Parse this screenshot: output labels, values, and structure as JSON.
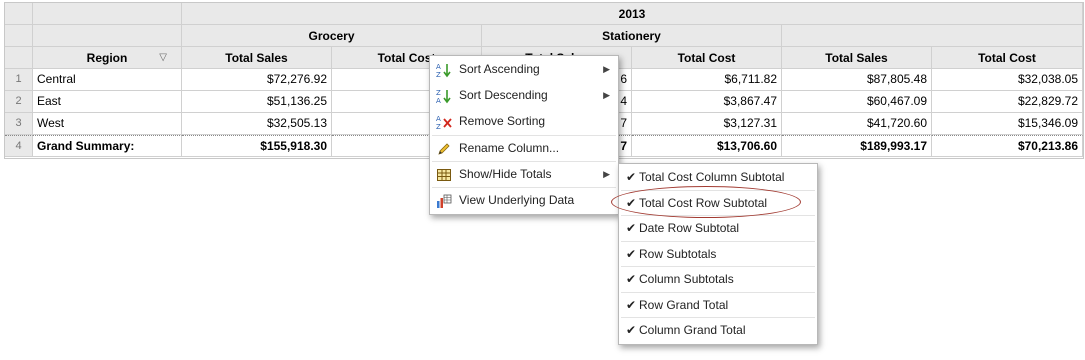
{
  "header": {
    "year": "2013",
    "groups": [
      "Grocery",
      "Stationery",
      ""
    ]
  },
  "columns": {
    "region": "Region",
    "total_sales": "Total Sales",
    "total_cost": "Total Cost"
  },
  "rows": [
    {
      "num": "1",
      "region": "Central",
      "g_sales": "$72,276.92",
      "g_cost": "$2",
      "s_sales": "6",
      "s_cost": "$6,711.82",
      "o_sales": "$87,805.48",
      "o_cost": "$32,038.05"
    },
    {
      "num": "2",
      "region": "East",
      "g_sales": "$51,136.25",
      "g_cost": "$1",
      "s_sales": "4",
      "s_cost": "$3,867.47",
      "o_sales": "$60,467.09",
      "o_cost": "$22,829.72"
    },
    {
      "num": "3",
      "region": "West",
      "g_sales": "$32,505.13",
      "g_cost": "$1",
      "s_sales": "7",
      "s_cost": "$3,127.31",
      "o_sales": "$41,720.60",
      "o_cost": "$15,346.09"
    }
  ],
  "summary": {
    "num": "4",
    "label": "Grand Summary:",
    "g_sales": "$155,918.30",
    "g_cost": "$56",
    "s_sales": "7",
    "s_cost": "$13,706.60",
    "o_sales": "$189,993.17",
    "o_cost": "$70,213.86"
  },
  "partial_header": "Total Sales",
  "context_menu": {
    "items": [
      {
        "label": "Sort Ascending",
        "icon": "sort-ascending-icon"
      },
      {
        "label": "Sort Descending",
        "icon": "sort-descending-icon"
      },
      {
        "label": "Remove Sorting",
        "icon": "remove-sorting-icon"
      },
      {
        "label": "Rename Column...",
        "icon": "pencil-icon"
      },
      {
        "label": "Show/Hide Totals",
        "icon": "table-icon"
      },
      {
        "label": "View Underlying Data",
        "icon": "data-view-icon"
      }
    ]
  },
  "submenu": {
    "items": [
      {
        "label": "Total Cost Column Subtotal"
      },
      {
        "label": "Total Cost Row Subtotal"
      },
      {
        "label": "Date Row Subtotal"
      },
      {
        "label": "Row Subtotals"
      },
      {
        "label": "Column Subtotals"
      },
      {
        "label": "Row Grand Total"
      },
      {
        "label": "Column Grand Total"
      }
    ]
  },
  "colors": {
    "header_bg": "#e9e9e9",
    "highlight": "#a23b32"
  }
}
